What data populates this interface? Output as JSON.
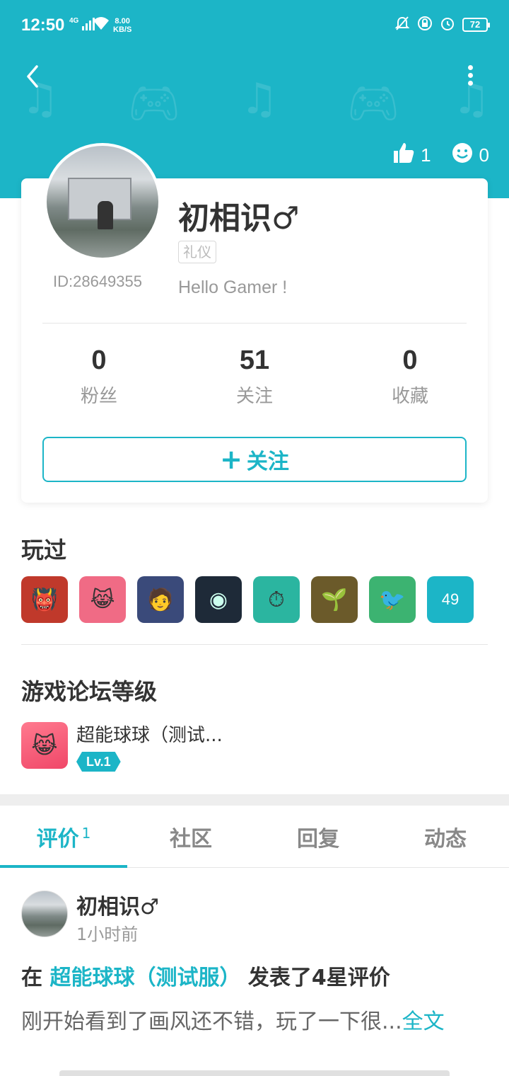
{
  "status_bar": {
    "time": "12:50",
    "network": "4G",
    "speed_value": "8.00",
    "speed_unit": "KB/S",
    "battery": "72"
  },
  "header": {
    "likes": "1",
    "smiles": "0"
  },
  "profile": {
    "name": "初相识♂",
    "tag": "礼仪",
    "bio": "Hello Gamer !",
    "id": "ID:28649355"
  },
  "stats": [
    {
      "value": "0",
      "label": "粉丝"
    },
    {
      "value": "51",
      "label": "关注"
    },
    {
      "value": "0",
      "label": "收藏"
    }
  ],
  "follow_button": {
    "icon": "+",
    "label": "关注"
  },
  "played": {
    "title": "玩过",
    "games": [
      {
        "icon": "tribal-mask-game-icon",
        "glyph": "👹",
        "color": "#c0392b"
      },
      {
        "icon": "pink-monster-game-icon",
        "glyph": "😹",
        "color": "#f06b85"
      },
      {
        "icon": "anime-boy-game-icon",
        "glyph": "🧑",
        "color": "#3a4a7a"
      },
      {
        "icon": "black-disc-game-icon",
        "glyph": "◉",
        "color": "#1e2a38"
      },
      {
        "icon": "stopwatch-game-icon",
        "glyph": "⏱",
        "color": "#2bb5a0"
      },
      {
        "icon": "plants-zombies-game-icon",
        "glyph": "🌱",
        "color": "#6b5a2a"
      },
      {
        "icon": "cartoon-bird-game-icon",
        "glyph": "🐦",
        "color": "#3cb371"
      }
    ],
    "more_count": "49"
  },
  "forum": {
    "title": "游戏论坛等级",
    "game_name": "超能球球（测试...",
    "level": "Lv.1"
  },
  "tabs": [
    {
      "label": "评价",
      "count": "1",
      "active": true
    },
    {
      "label": "社区",
      "count": "",
      "active": false
    },
    {
      "label": "回复",
      "count": "",
      "active": false
    },
    {
      "label": "动态",
      "count": "",
      "active": false
    }
  ],
  "post": {
    "author": "初相识♂",
    "time": "1小时前",
    "prefix": "在 ",
    "game": "超能球球（测试服）",
    "suffix": " 发表了4星评价",
    "body": "刚开始看到了画风还不错，玩了一下很...",
    "read_more": "全文"
  },
  "colors": {
    "accent": "#1cb5c7"
  }
}
